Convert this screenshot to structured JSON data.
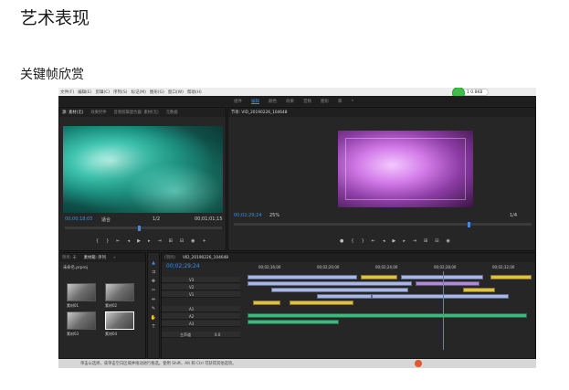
{
  "document": {
    "title": "艺术表现",
    "subtitle": "关键帧欣赏"
  },
  "premiere": {
    "menu": [
      "文件(F)",
      "编辑(E)",
      "剪辑(C)",
      "序列(S)",
      "标记(M)",
      "图形(G)",
      "窗口(W)",
      "帮助(H)"
    ],
    "workspaces": [
      "组件",
      "编辑",
      "颜色",
      "效果",
      "音频",
      "图形",
      "库",
      "»"
    ],
    "active_workspace": "编辑",
    "account_badge": "1 0.8KB",
    "source_tabs": [
      "源: 素材(无)",
      "效果控件",
      "音频剪辑混合器: 素材(无)",
      "元数据"
    ],
    "program_tab": "节目: VID_20190226_104648",
    "source_timecode_in": "00;00;18;05",
    "source_fit": "适合",
    "source_res": "1/2",
    "source_timecode_out": "00;01;01;15",
    "program_timecode_in": "00;02;29;24",
    "program_zoom": "25%",
    "program_res": "1/4",
    "project_tabs": [
      "项目: 未",
      "素材箱: 序列",
      "»"
    ],
    "project_path": "未命名.prproj",
    "project_items": [
      "素材01",
      "素材02",
      "素材03",
      "素材04"
    ],
    "timeline_tabs": [
      "(项目)",
      "VID_20190226_104648"
    ],
    "timeline_timecode": "00;02;29;24",
    "ruler_labels": [
      "00;02;16;00",
      "00;02;20;00",
      "00;02;24;00",
      "00;02;28;00",
      "00;02;32;00"
    ],
    "tracks": [
      "V3",
      "V2",
      "V1",
      "A1",
      "A2",
      "A3",
      "主声道"
    ],
    "master_value": "0.0",
    "status_text": "单击以选择，或单击空白区域并拖动进行框选。使用 Shift、Alt 和 Ctrl 可获得其他选项。"
  },
  "colors": {
    "accent": "#3d8ee0",
    "video_clip": "#a7b7e8",
    "yellow_clip": "#e0c148",
    "audio_clip": "#3db87f"
  }
}
